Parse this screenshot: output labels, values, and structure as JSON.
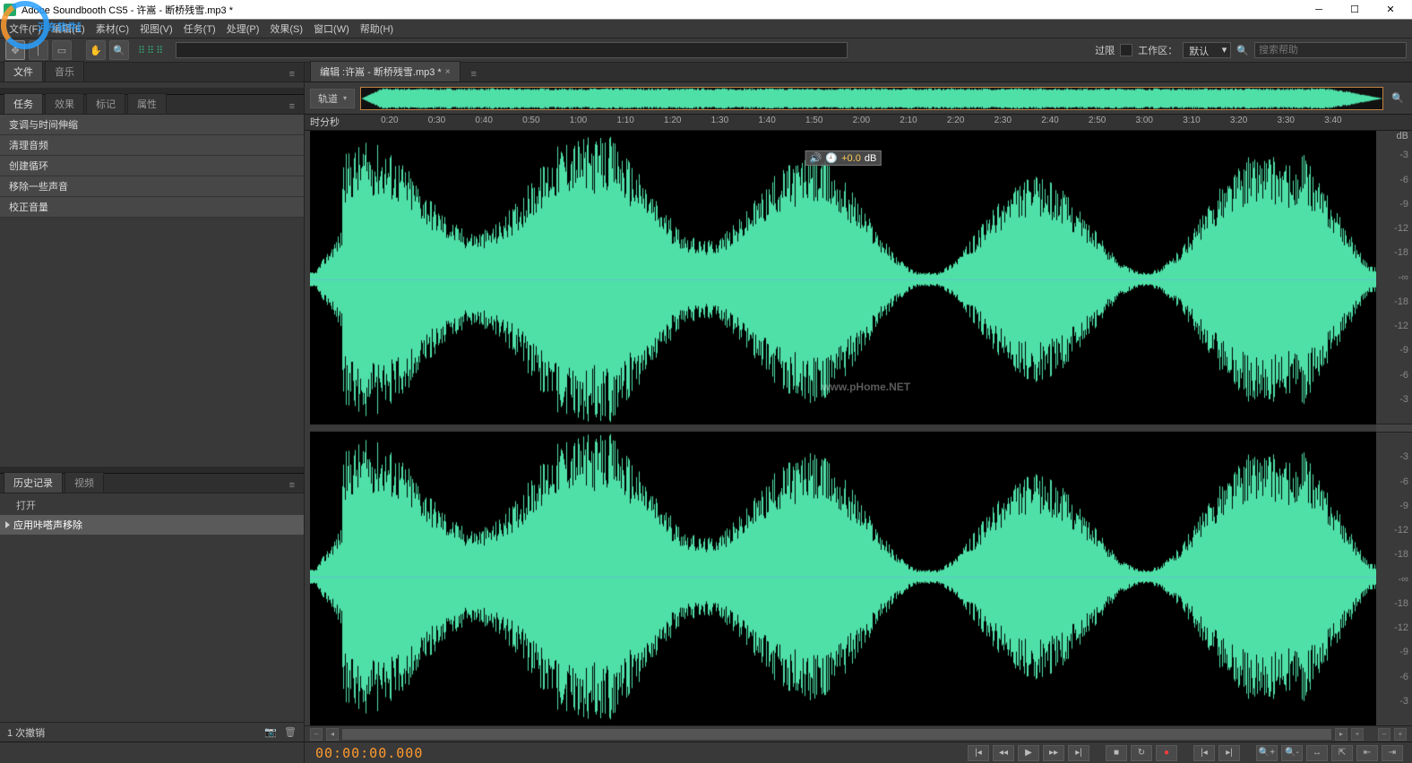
{
  "window": {
    "title": "Adobe Soundbooth CS5 - 许嵩 - 断桥残雪.mp3 *"
  },
  "menubar": {
    "items": [
      "文件(F)",
      "编辑(E)",
      "素材(C)",
      "视图(V)",
      "任务(T)",
      "处理(P)",
      "效果(S)",
      "窗口(W)",
      "帮助(H)"
    ]
  },
  "toolbar": {
    "limit_label": "过限",
    "workspace_label": "工作区：",
    "workspace_value": "默认",
    "search_placeholder": "搜索帮助"
  },
  "left": {
    "top_tabs": [
      "文件",
      "音乐"
    ],
    "task_tabs": [
      "任务",
      "效果",
      "标记",
      "属性"
    ],
    "tasks": [
      "变调与时间伸缩",
      "清理音频",
      "创建循环",
      "移除一些声音",
      "校正音量"
    ],
    "history_tabs": [
      "历史记录",
      "视频"
    ],
    "history_items": [
      "打开",
      "应用咔嗒声移除"
    ],
    "history_selected_index": 1,
    "undo_count_label": "1 次撤销"
  },
  "editor": {
    "tab_label": "编辑 :许嵩 - 断桥残雪.mp3 *",
    "track_button": "轨道",
    "ruler_label": "时分秒",
    "time_ticks": [
      "0:20",
      "0:30",
      "0:40",
      "0:50",
      "1:00",
      "1:10",
      "1:20",
      "1:30",
      "1:40",
      "1:50",
      "2:00",
      "2:10",
      "2:20",
      "2:30",
      "2:40",
      "2:50",
      "3:00",
      "3:10",
      "3:20",
      "3:30",
      "3:40"
    ],
    "gain_value_db": "+0.0",
    "gain_unit": "dB",
    "db_header": "dB",
    "db_scale": [
      "-3",
      "-6",
      "-9",
      "-12",
      "-18",
      "-∞",
      "-18",
      "-12",
      "-9",
      "-6",
      "-3"
    ],
    "watermark_text": "www.pHome.NET"
  },
  "status": {
    "timecode": "00:00:00.000"
  },
  "colors": {
    "waveform": "#4fe0a8",
    "timecode": "#ff9a2e"
  }
}
